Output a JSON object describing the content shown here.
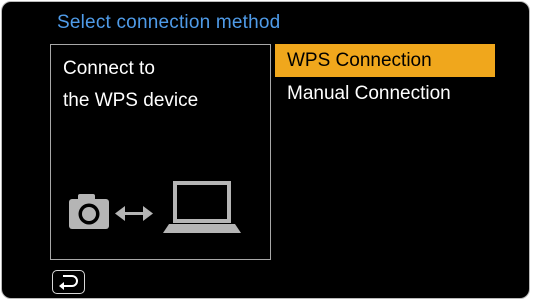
{
  "header": {
    "title": "Select connection method"
  },
  "info_panel": {
    "line1": "Connect to",
    "line2": "the WPS device",
    "diagram_icons": [
      "camera-icon",
      "double-arrow-icon",
      "laptop-icon"
    ]
  },
  "menu": {
    "items": [
      {
        "label": "WPS Connection",
        "selected": true
      },
      {
        "label": "Manual Connection",
        "selected": false
      }
    ]
  },
  "footer": {
    "back_icon": "return-arrow-icon"
  },
  "colors": {
    "title": "#4f9be8",
    "selection": "#f0a71c",
    "background": "#000000",
    "icon_gray": "#b5b5b5"
  }
}
